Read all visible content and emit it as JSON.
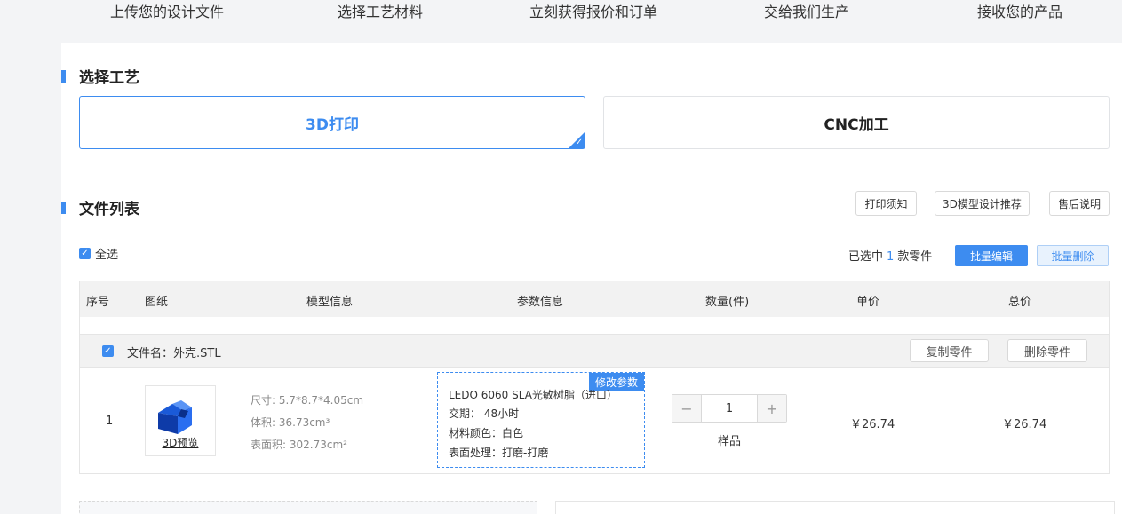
{
  "steps": [
    "上传您的设计文件",
    "选择工艺材料",
    "立刻获得报价和订单",
    "交给我们生产",
    "接收您的产品"
  ],
  "process": {
    "title": "选择工艺",
    "options": [
      {
        "label": "3D打印",
        "active": true
      },
      {
        "label": "CNC加工",
        "active": false
      }
    ]
  },
  "files": {
    "title": "文件列表",
    "toolbar": {
      "print_notice": "打印须知",
      "design_recommend": "3D模型设计推荐",
      "after_sales": "售后说明"
    },
    "select_all_label": "全选",
    "selected_prefix": "已选中",
    "selected_count": "1",
    "selected_suffix": "款零件",
    "batch_edit": "批量编辑",
    "batch_delete": "批量删除",
    "columns": [
      "序号",
      "图纸",
      "模型信息",
      "参数信息",
      "数量(件)",
      "单价",
      "总价"
    ],
    "file_row": {
      "file_name": "文件名：外壳.STL",
      "copy_part": "复制零件",
      "delete_part": "删除零件"
    },
    "item": {
      "index": "1",
      "preview_label": "3D预览",
      "size": "尺寸: 5.7*8.7*4.05cm",
      "volume": "体积: 36.73cm³",
      "surface": "表面积: 302.73cm²",
      "edit_params": "修改参数",
      "material": "LEDO 6060   SLA光敏树脂（进口）",
      "lead_time": "交期：  48小时",
      "color": "材料颜色：白色",
      "surface_treatment": "表面处理：打磨-打磨",
      "quantity": "1",
      "minus": "−",
      "plus": "+",
      "quantity_note": "样品",
      "unit_price": "￥26.74",
      "total_price": "￥26.74"
    }
  },
  "colors": {
    "accent": "#3d8cf0",
    "header_bg": "#f2f2f2"
  }
}
